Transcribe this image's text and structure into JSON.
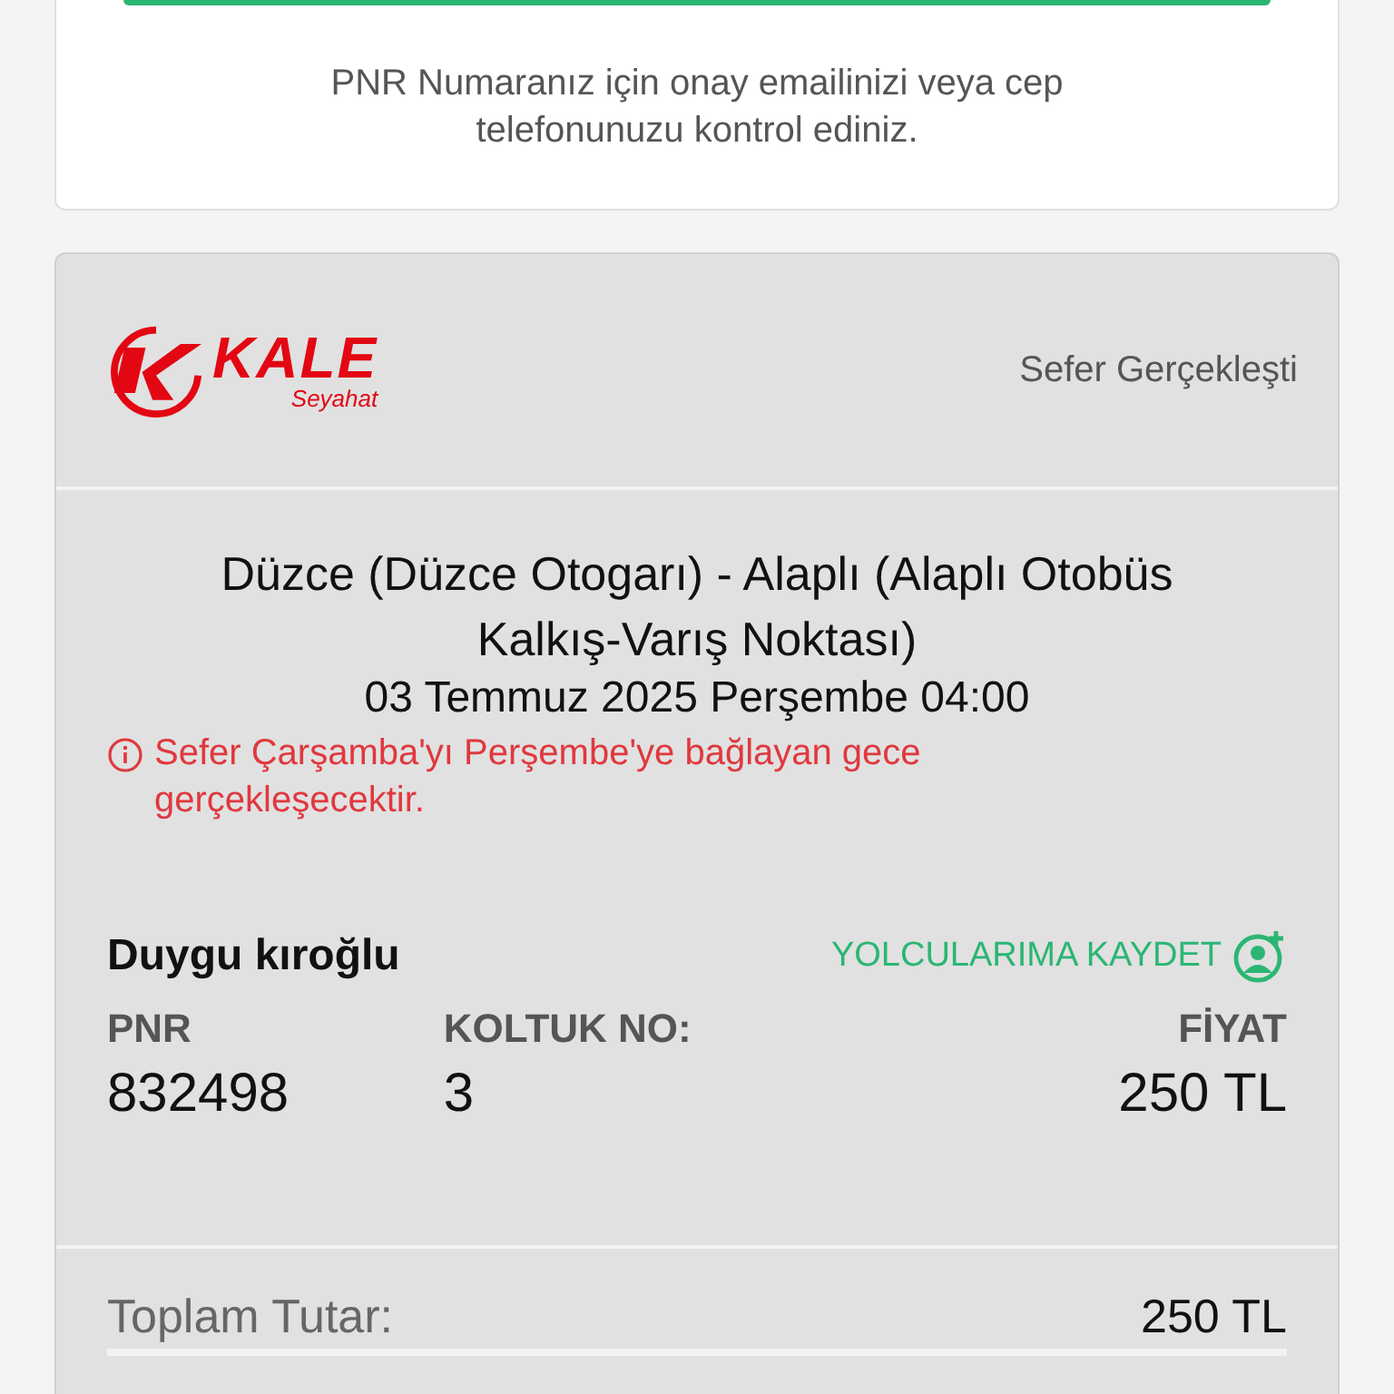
{
  "notice_card": {
    "message": "PNR Numaranız için onay emailinizi veya cep telefonunuzu kontrol ediniz."
  },
  "ticket": {
    "logo": {
      "name": "KALE",
      "subtitle": "Seyahat"
    },
    "status": "Sefer Gerçekleşti",
    "route": "Düzce (Düzce Otogarı) - Alaplı (Alaplı Otobüs Kalkış-Varış Noktası)",
    "datetime": "03 Temmuz 2025 Perşembe 04:00",
    "warning": "Sefer Çarşamba'yı Perşembe'ye bağlayan gece gerçekleşecektir.",
    "passenger": {
      "name": "Duygu kıroğlu",
      "save_link": "YOLCULARIMA KAYDET",
      "fields": [
        {
          "label": "PNR",
          "value": "832498",
          "kind": "start"
        },
        {
          "label": "KOLTUK NO:",
          "value": "3",
          "kind": "start"
        },
        {
          "label": "FİYAT",
          "value": "250 TL",
          "kind": "end"
        }
      ]
    },
    "total": {
      "label": "Toplam Tutar:",
      "value": "250 TL"
    }
  }
}
